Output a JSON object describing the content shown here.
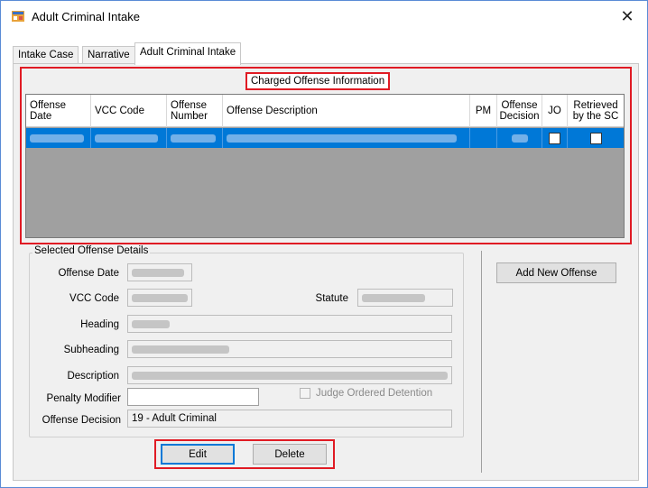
{
  "window": {
    "title": "Adult Criminal Intake",
    "app_icon": "form-window-icon",
    "close_glyph": "✕"
  },
  "tabs": [
    {
      "label": "Intake Case",
      "active": false
    },
    {
      "label": "Narrative",
      "active": false
    },
    {
      "label": "Adult Criminal Intake",
      "active": true
    }
  ],
  "charged_offense": {
    "group_title": "Charged Offense Information",
    "columns": [
      "Offense Date",
      "VCC Code",
      "Offense Number",
      "Offense Description",
      "PM",
      "Offense Decision",
      "JO",
      "Retrieved by the SC"
    ],
    "rows": [
      {
        "offense_date": "",
        "vcc_code": "",
        "offense_number": "",
        "offense_description": "",
        "pm": "",
        "offense_decision": "",
        "jo": false,
        "retrieved_by_sc": false
      }
    ]
  },
  "details": {
    "legend": "Selected Offense Details",
    "offense_date_label": "Offense Date",
    "vcc_code_label": "VCC Code",
    "statute_label": "Statute",
    "heading_label": "Heading",
    "subheading_label": "Subheading",
    "description_label": "Description",
    "penalty_modifier_label": "Penalty Modifier",
    "penalty_modifier_value": "",
    "judge_ordered_detention_label": "Judge Ordered Detention",
    "judge_ordered_detention_checked": false,
    "offense_decision_label": "Offense Decision",
    "offense_decision_value": "19 - Adult Criminal"
  },
  "buttons": {
    "edit": "Edit",
    "delete": "Delete",
    "add_new_offense": "Add New Offense"
  },
  "colors": {
    "highlight_red": "#e01b24",
    "selection_blue": "#0078d7",
    "grid_bg": "#a0a0a0"
  }
}
